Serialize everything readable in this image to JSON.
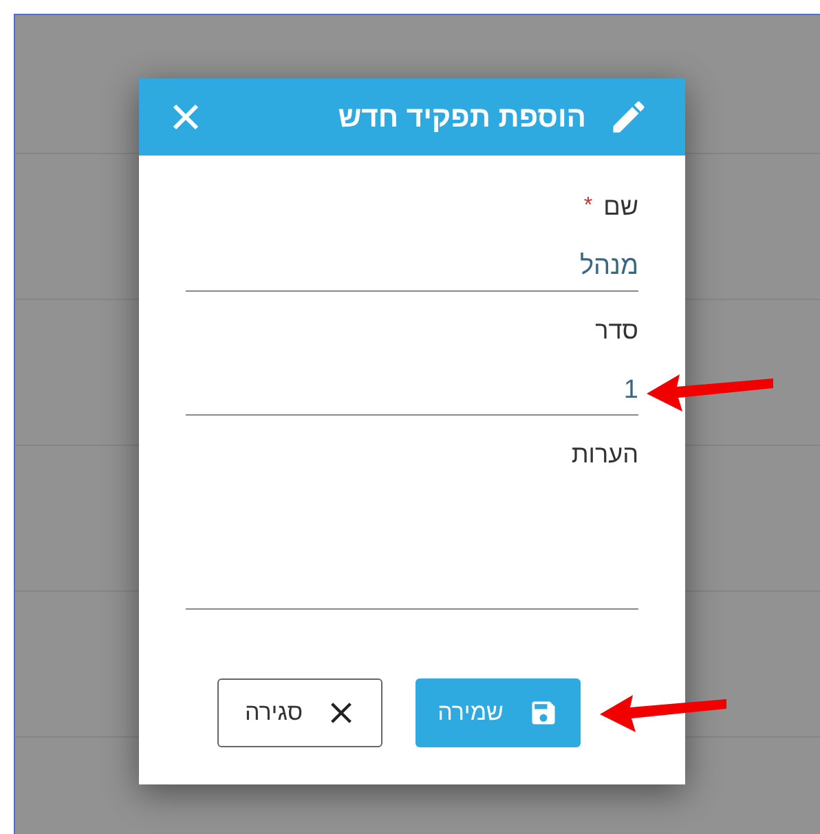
{
  "dialog": {
    "title": "הוספת תפקיד חדש",
    "fields": [
      {
        "kind": "text",
        "label": "שם",
        "required_mark": "*",
        "value": "מנהל"
      },
      {
        "kind": "text",
        "label": "סדר",
        "value": "1",
        "arrow": {
          "kind": "pointer"
        }
      },
      {
        "kind": "textarea",
        "label": "הערות"
      }
    ],
    "buttons": [
      {
        "kind": "save",
        "label": "שמירה",
        "arrow": {
          "kind": "pointer"
        }
      },
      {
        "kind": "close",
        "label": "סגירה"
      }
    ]
  }
}
